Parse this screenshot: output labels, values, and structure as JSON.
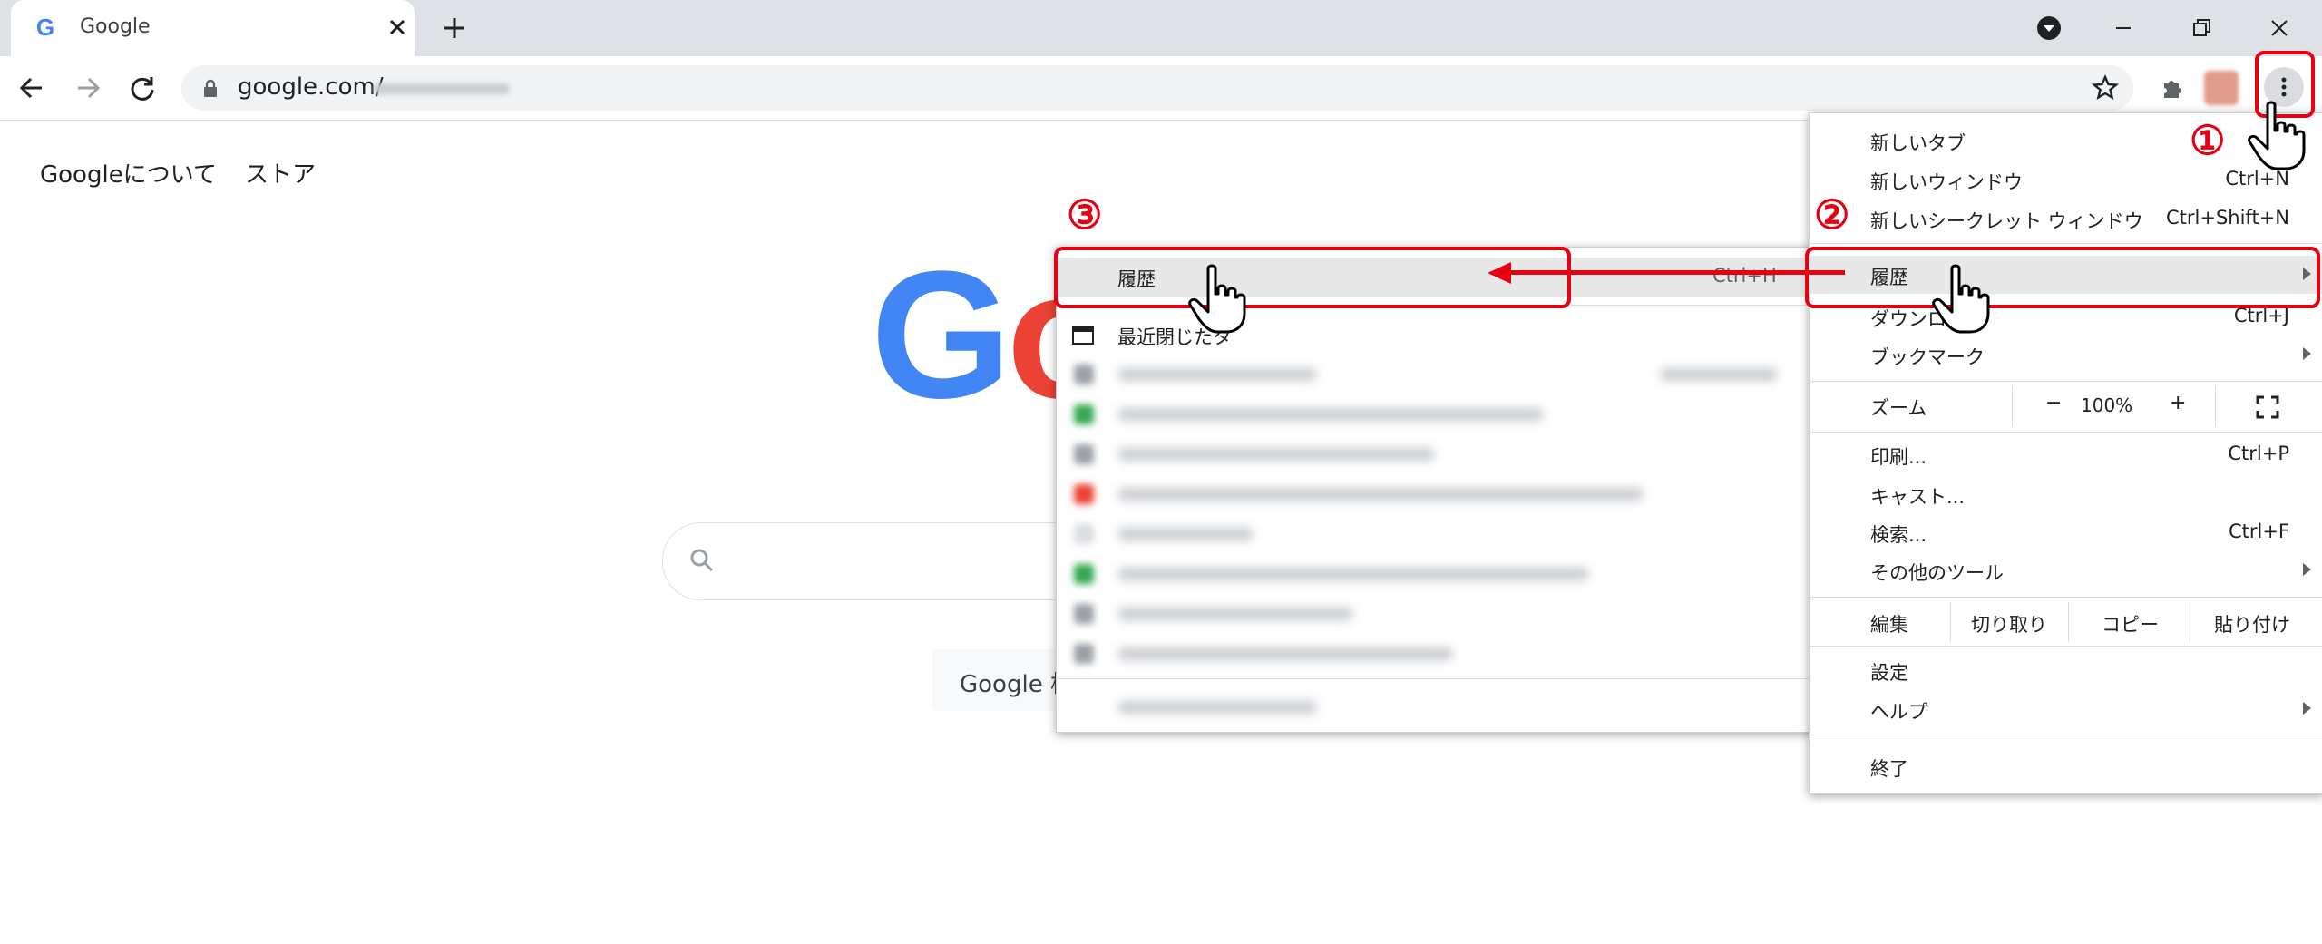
{
  "tab": {
    "title": "Google"
  },
  "toolbar": {
    "url": "google.com/"
  },
  "page": {
    "links": [
      "Googleについて",
      "ストア"
    ],
    "logo_letters": [
      "G",
      "o"
    ],
    "search_button_label": "Google 検"
  },
  "chrome_menu": {
    "items": [
      {
        "label": "新しいタブ",
        "shortcut": ""
      },
      {
        "label": "新しいウィンドウ",
        "shortcut": "Ctrl+N"
      },
      {
        "label": "新しいシークレット ウィンドウ",
        "shortcut": "Ctrl+Shift+N"
      },
      {
        "label": "履歴",
        "shortcut": ""
      },
      {
        "label": "ダウンロ",
        "shortcut": "Ctrl+J"
      },
      {
        "label": "ブックマーク",
        "shortcut": ""
      }
    ],
    "zoom": {
      "label": "ズーム",
      "minus": "−",
      "value": "100%",
      "plus": "+"
    },
    "items2": [
      {
        "label": "印刷...",
        "shortcut": "Ctrl+P"
      },
      {
        "label": "キャスト...",
        "shortcut": ""
      },
      {
        "label": "検索...",
        "shortcut": "Ctrl+F"
      },
      {
        "label": "その他のツール",
        "shortcut": ""
      }
    ],
    "edit": {
      "label": "編集",
      "cut": "切り取り",
      "copy": "コピー",
      "paste": "貼り付け"
    },
    "settings": "設定",
    "help": "ヘルプ",
    "exit": "終了"
  },
  "history_menu": {
    "history": "履歴",
    "history_shortcut": "Ctrl+H",
    "recently_closed": "最近閉じたタ"
  },
  "annotations": {
    "step1": "①",
    "step2": "②",
    "step3": "③"
  },
  "colors": {
    "annotation_red": "#e60012",
    "menu_highlight": "#e8e8e8"
  }
}
